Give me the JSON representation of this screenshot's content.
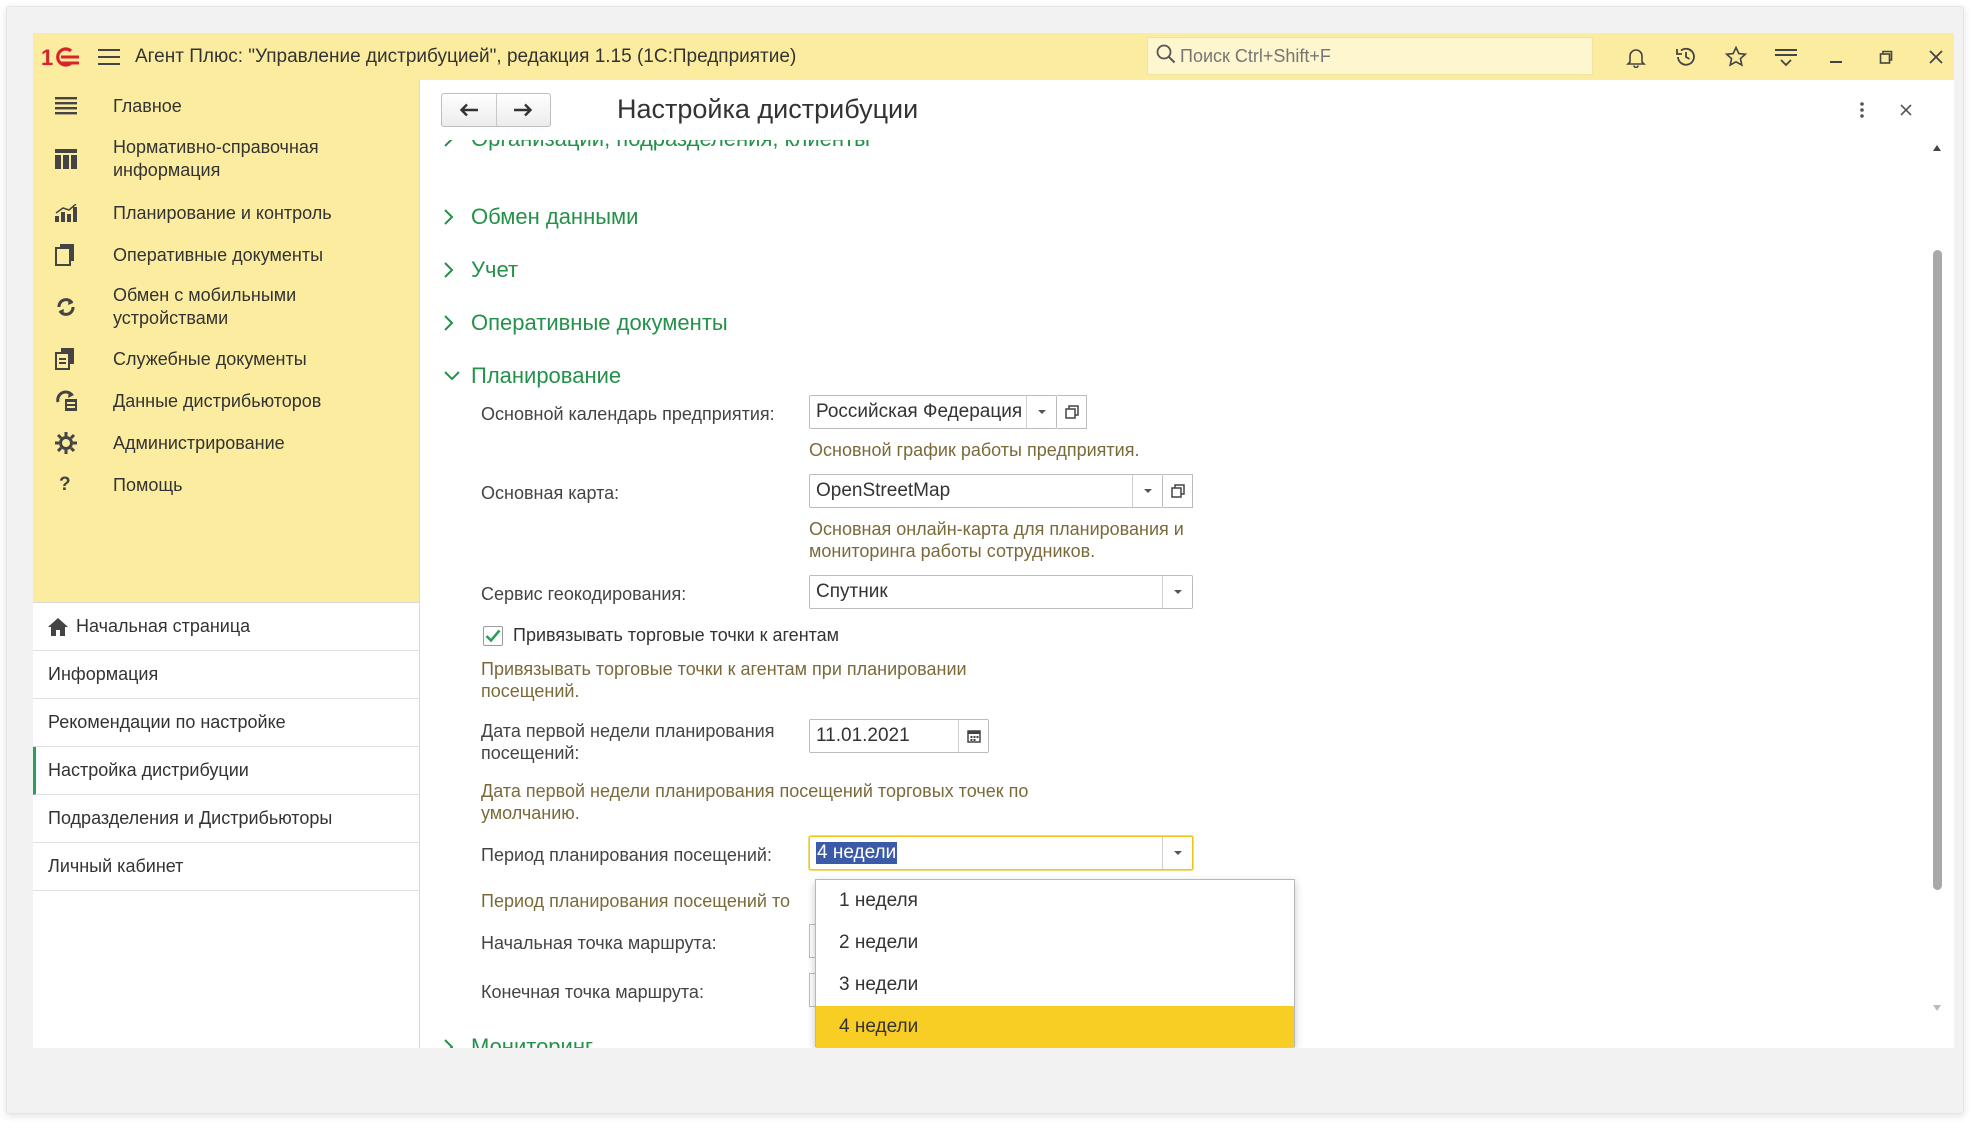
{
  "titlebar": {
    "app_title": "Агент Плюс: \"Управление дистрибуцией\", редакция 1.15  (1С:Предприятие)",
    "search_placeholder": "Поиск Ctrl+Shift+F"
  },
  "sidebar": {
    "sections": [
      {
        "label": "Главное",
        "icon": "menu-lines-icon"
      },
      {
        "label": "Нормативно-справочная информация",
        "icon": "table-grid-icon"
      },
      {
        "label": "Планирование и контроль",
        "icon": "bar-chart-icon"
      },
      {
        "label": "Оперативные документы",
        "icon": "documents-icon"
      },
      {
        "label": "Обмен с мобильными устройствами",
        "icon": "sync-icon"
      },
      {
        "label": "Служебные документы",
        "icon": "service-docs-icon"
      },
      {
        "label": "Данные дистрибьюторов",
        "icon": "distributor-data-icon"
      },
      {
        "label": "Администрирование",
        "icon": "gear-icon"
      },
      {
        "label": "Помощь",
        "icon": "question-icon"
      }
    ],
    "nav": [
      {
        "label": "Начальная страница"
      },
      {
        "label": "Информация"
      },
      {
        "label": "Рекомендации по настройке"
      },
      {
        "label": "Настройка дистрибуции"
      },
      {
        "label": "Подразделения и Дистрибьюторы"
      },
      {
        "label": "Личный кабинет"
      }
    ]
  },
  "form": {
    "title": "Настройка дистрибуции",
    "groups": {
      "orgs": "Организации, подразделения, клиенты",
      "exchange": "Обмен данными",
      "accounting": "Учет",
      "op_docs": "Оперативные документы",
      "planning": "Планирование",
      "monitoring": "Мониторинг"
    },
    "calendar": {
      "label": "Основной календарь предприятия:",
      "value": "Российская Федерация",
      "hint": "Основной график работы предприятия."
    },
    "map": {
      "label": "Основная карта:",
      "value": "OpenStreetMap",
      "hint_line1": "Основная онлайн-карта для планирования и",
      "hint_line2": "мониторинга работы сотрудников."
    },
    "geocoding": {
      "label": "Сервис геокодирования:",
      "value": "Спутник"
    },
    "bind_outlets": {
      "label": "Привязывать торговые точки к агентам",
      "hint_line1": "Привязывать торговые точки к агентам при планировании",
      "hint_line2": "посещений."
    },
    "first_week": {
      "label_line1": "Дата первой недели планирования",
      "label_line2": "посещений:",
      "value": "11.01.2021",
      "hint_line1": "Дата первой недели планирования посещений торговых точек по",
      "hint_line2": "умолчанию."
    },
    "period": {
      "label": "Период планирования посещений:",
      "value": "4 недели",
      "hint": "Период планирования посещений то"
    },
    "route_start": {
      "label": "Начальная точка маршрута:"
    },
    "route_end": {
      "label": "Конечная точка маршрута:"
    }
  },
  "dropdown": {
    "options": [
      "1 неделя",
      "2 недели",
      "3 недели",
      "4 недели"
    ],
    "selected": "4 недели"
  },
  "colors": {
    "accent_yellow": "#fbec9f",
    "group_green": "#24914a",
    "selected_option": "#f9ce24",
    "logo_red": "#d8232a"
  }
}
